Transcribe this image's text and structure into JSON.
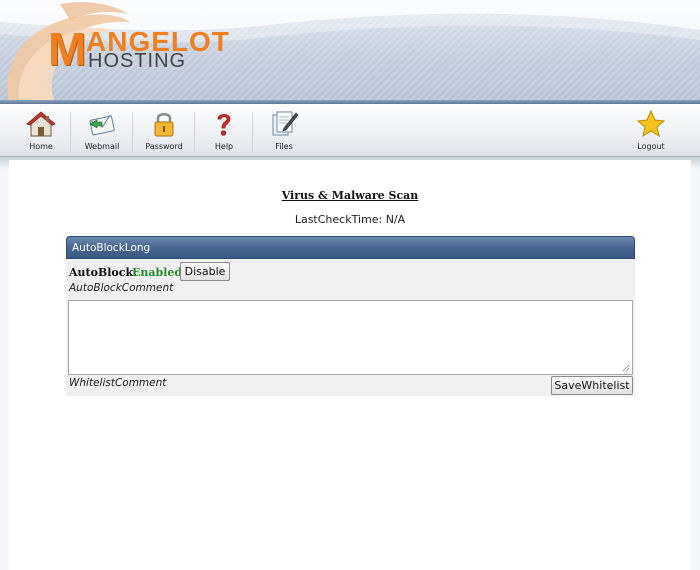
{
  "brand": {
    "logo_m": "M",
    "logo_top": "ANGELOT",
    "logo_bottom": "HOSTING",
    "accent_color": "#f07f1f"
  },
  "toolbar": {
    "items": [
      {
        "label": "Home",
        "icon": "house-icon"
      },
      {
        "label": "Webmail",
        "icon": "mail-icon"
      },
      {
        "label": "Password",
        "icon": "padlock-icon"
      },
      {
        "label": "Help",
        "icon": "question-mark-icon"
      },
      {
        "label": "Files",
        "icon": "document-pen-icon"
      },
      {
        "label": "Logout",
        "icon": "star-icon"
      }
    ]
  },
  "main": {
    "title": "Virus & Malware Scan",
    "last_check": "LastCheckTime: N/A"
  },
  "panel": {
    "header": "AutoBlockLong",
    "autoblock_label": "AutoBlock:",
    "autoblock_status": "Enabled",
    "status_color": "#2a8a2a",
    "disable_button": "Disable",
    "autoblock_comment": "AutoBlockComment",
    "whitelist_value": "",
    "whitelist_comment": "WhitelistComment",
    "save_button": "SaveWhitelist"
  }
}
